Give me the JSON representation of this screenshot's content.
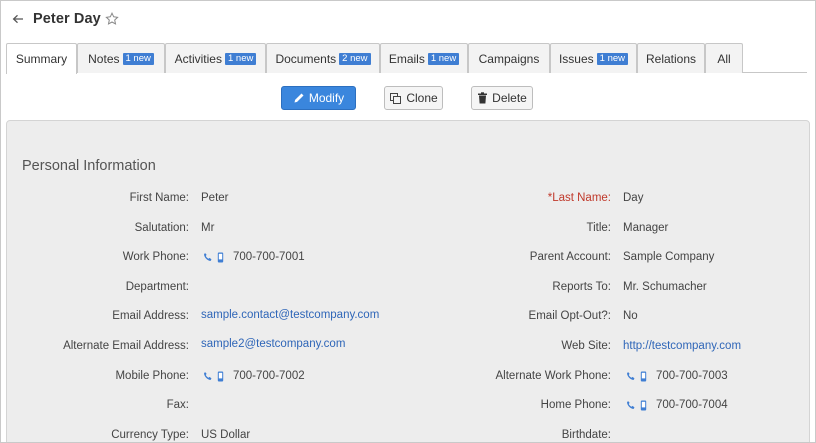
{
  "header": {
    "title": "Peter Day"
  },
  "tabs": [
    {
      "label": "Summary",
      "badge": ""
    },
    {
      "label": "Notes",
      "badge": "1 new"
    },
    {
      "label": "Activities",
      "badge": "1 new"
    },
    {
      "label": "Documents",
      "badge": "2 new"
    },
    {
      "label": "Emails",
      "badge": "1 new"
    },
    {
      "label": "Campaigns",
      "badge": ""
    },
    {
      "label": "Issues",
      "badge": "1 new"
    },
    {
      "label": "Relations",
      "badge": ""
    },
    {
      "label": "All",
      "badge": ""
    }
  ],
  "actions": {
    "modify": "Modify",
    "clone": "Clone",
    "delete": "Delete"
  },
  "section": {
    "title": "Personal Information"
  },
  "fields_left": [
    {
      "label": "First Name:",
      "value": "Peter"
    },
    {
      "label": "Salutation:",
      "value": "Mr"
    },
    {
      "label": "Work Phone:",
      "value": "700-700-7001"
    },
    {
      "label": "Department:",
      "value": ""
    },
    {
      "label": "Email Address:",
      "value": "sample.contact@testcompany.com"
    },
    {
      "label": "Alternate Email Address:",
      "value": "sample2@testcompany.com"
    },
    {
      "label": "Mobile Phone:",
      "value": "700-700-7002"
    },
    {
      "label": "Fax:",
      "value": ""
    },
    {
      "label": "Currency Type:",
      "value": "US Dollar"
    }
  ],
  "fields_right": [
    {
      "label": "*Last Name:",
      "value": "Day"
    },
    {
      "label": "Title:",
      "value": "Manager"
    },
    {
      "label": "Parent Account:",
      "value": "Sample Company"
    },
    {
      "label": "Reports To:",
      "value": "Mr. Schumacher"
    },
    {
      "label": "Email Opt-Out?:",
      "value": "No"
    },
    {
      "label": "Web Site:",
      "value": "http://testcompany.com"
    },
    {
      "label": "Alternate Work Phone:",
      "value": "700-700-7003"
    },
    {
      "label": "Home Phone:",
      "value": "700-700-7004"
    },
    {
      "label": "Birthdate:",
      "value": ""
    }
  ],
  "colors": {
    "accent": "#3a86dd",
    "badge": "#3f7ed3",
    "link": "#2f66b8",
    "required": "#c0392b",
    "panel": "#ededed"
  },
  "icons": {
    "back": "arrow-left-icon",
    "favorite": "star-icon",
    "modify": "pencil-icon",
    "clone": "copy-icon",
    "delete": "trash-icon",
    "phone": "phone-icon",
    "mobile": "mobile-icon"
  }
}
